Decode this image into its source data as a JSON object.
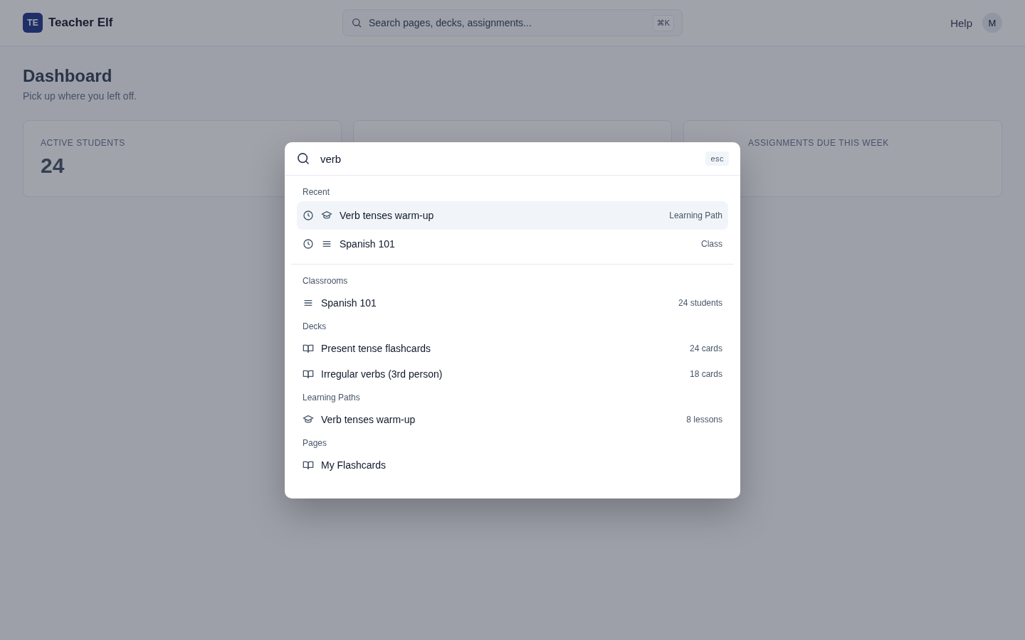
{
  "header": {
    "logo": "TE",
    "app_name": "Teacher Elf",
    "search": {
      "placeholder": "Search pages, decks, assignments...",
      "shortcut": "⌘K"
    },
    "help": "Help",
    "avatar": "M"
  },
  "page": {
    "title": "Dashboard",
    "subtitle": "Pick up where you left off."
  },
  "stats": [
    {
      "label": "ACTIVE STUDENTS",
      "value": "24"
    },
    {
      "label": "ASSIGNMENTS DUE THIS WEEK"
    }
  ],
  "palette": {
    "query": "verb",
    "esc": "esc",
    "sections": [
      {
        "title": "Recent",
        "recent": true,
        "items": [
          {
            "kind": "path",
            "label": "Verb tenses warm-up",
            "meta": "Learning Path",
            "selected": true
          },
          {
            "kind": "class",
            "label": "Spanish 101",
            "meta": "Class",
            "selected": false
          }
        ]
      },
      {
        "title": "Classrooms",
        "recent": false,
        "items": [
          {
            "kind": "class",
            "label": "Spanish 101",
            "meta": "24 students",
            "selected": false
          }
        ]
      },
      {
        "title": "Decks",
        "recent": false,
        "items": [
          {
            "kind": "deck",
            "label": "Present tense flashcards",
            "meta": "24 cards",
            "selected": false
          },
          {
            "kind": "deck",
            "label": "Irregular verbs (3rd person)",
            "meta": "18 cards",
            "selected": false
          }
        ]
      },
      {
        "title": "Learning Paths",
        "recent": false,
        "items": [
          {
            "kind": "path",
            "label": "Verb tenses warm-up",
            "meta": "8 lessons",
            "selected": false
          }
        ]
      },
      {
        "title": "Pages",
        "recent": false,
        "items": [
          {
            "kind": "deck",
            "label": "My Flashcards",
            "selected": false
          }
        ]
      }
    ]
  }
}
